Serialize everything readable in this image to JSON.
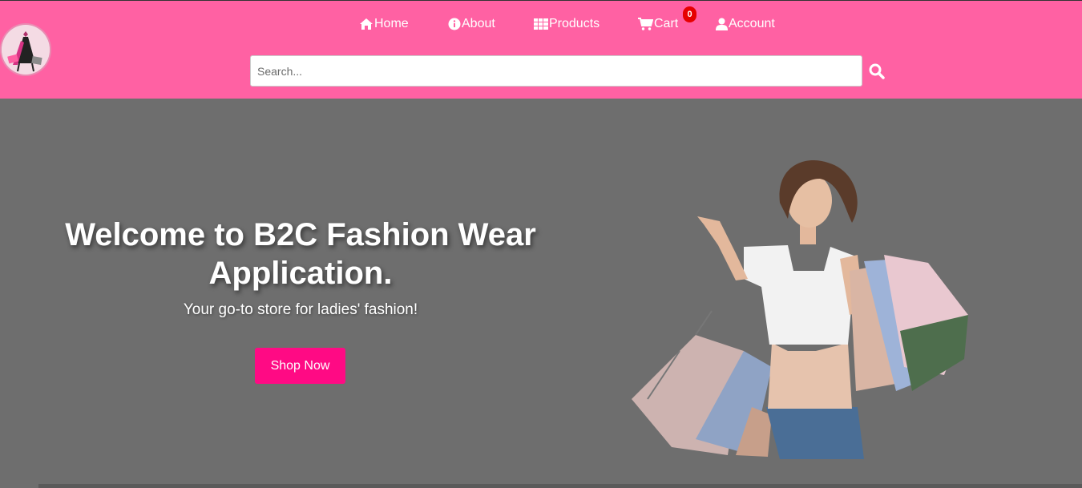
{
  "nav": {
    "items": [
      {
        "label": "Home",
        "icon": "home-icon"
      },
      {
        "label": "About",
        "icon": "info-icon"
      },
      {
        "label": "Products",
        "icon": "grid-icon"
      },
      {
        "label": "Cart",
        "icon": "cart-icon"
      },
      {
        "label": "Account",
        "icon": "user-icon"
      }
    ],
    "cart_count": "0"
  },
  "search": {
    "placeholder": "Search...",
    "value": ""
  },
  "hero": {
    "title": "Welcome to B2C Fashion Wear Application.",
    "subtitle": "Your go-to store for ladies' fashion!",
    "cta_label": "Shop Now"
  },
  "colors": {
    "header_bg": "#ff61a3",
    "hero_bg": "#6e6e6e",
    "cta_bg": "#ff0a84",
    "badge_bg": "#e60000"
  }
}
